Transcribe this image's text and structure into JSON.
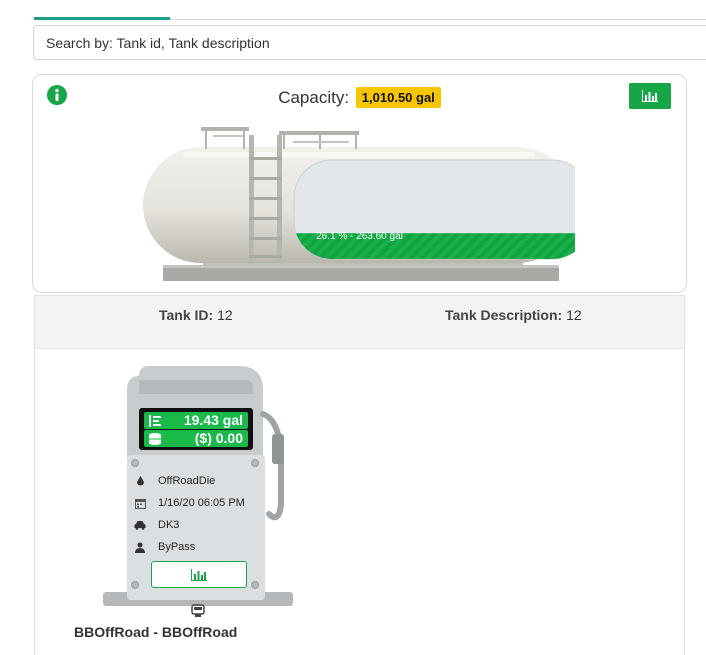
{
  "search": {
    "placeholder": "Search by: Tank id, Tank description"
  },
  "capacity": {
    "label": "Capacity:",
    "value": "1,010.50 gal",
    "fill_text": "26.1 % - 263.60 gal",
    "fill_percent": 26.1
  },
  "details": {
    "tank_id_label": "Tank ID:",
    "tank_id_value": "12",
    "tank_desc_label": "Tank Description:",
    "tank_desc_value": "12"
  },
  "pump": {
    "gallons": "19.43 gal",
    "amount": "($) 0.00",
    "rows": [
      {
        "icon": "drop-icon",
        "text": "OffRoadDie"
      },
      {
        "icon": "calendar-icon",
        "text": "1/16/20 06:05 PM"
      },
      {
        "icon": "car-icon",
        "text": "DK3"
      },
      {
        "icon": "user-icon",
        "text": "ByPass"
      }
    ],
    "name": "BBOffRoad - BBOffRoad"
  },
  "icons": {
    "info": "info-icon",
    "chart_button": "bar-chart-icon",
    "pump_base": "fuel-nozzle-icon"
  },
  "colors": {
    "accent_green": "#17a645",
    "capacity_badge": "#f7c600",
    "tab_indicator": "#1e9e8a",
    "display_bg": "#101010"
  }
}
